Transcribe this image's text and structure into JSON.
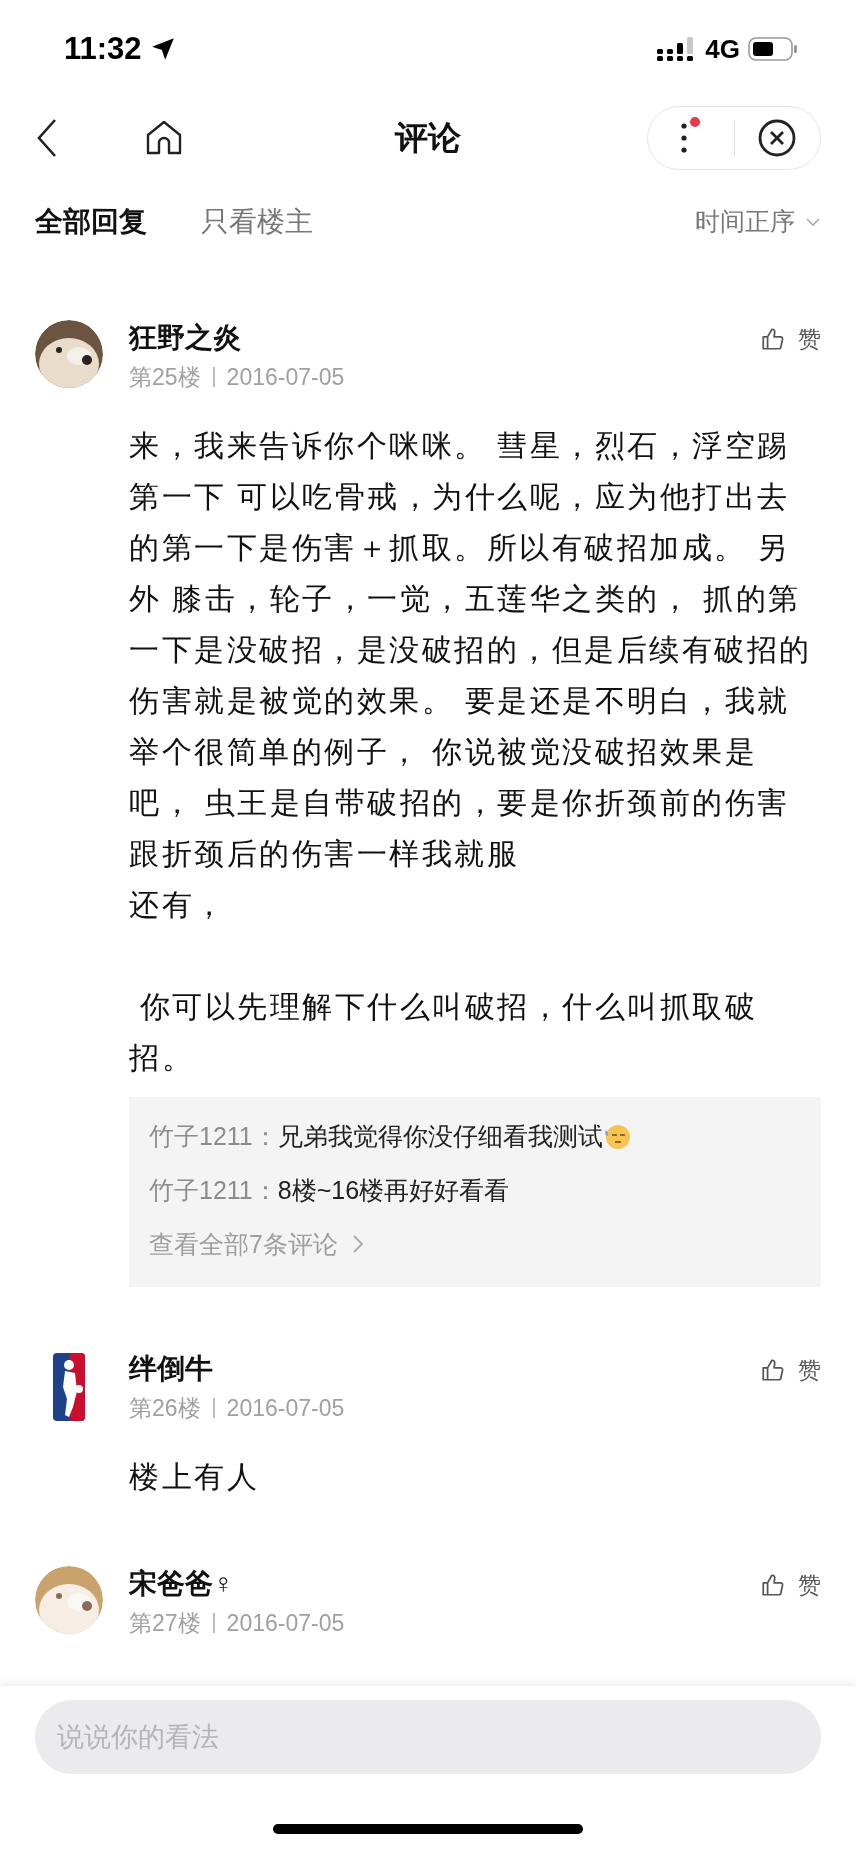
{
  "status_bar": {
    "time": "11:32",
    "network": "4G"
  },
  "nav": {
    "title": "评论"
  },
  "tabs": [
    {
      "label": "全部回复",
      "selected": true
    },
    {
      "label": "只看楼主",
      "selected": false
    }
  ],
  "sort": {
    "label": "时间正序"
  },
  "posts": [
    {
      "name": "狂野之炎",
      "floor": "第25楼",
      "date": "2016-07-05",
      "like": "赞",
      "body": [
        {
          "text": "来，我来告诉你个咪咪。 彗星，烈石，浮空踢第一下 可以吃骨戒，为什么呢，应为他打出去的第一下是伤害＋抓取。所以有破招加成。 另外 膝击，轮子，一觉，五莲华之类的， 抓的第一下是没破招，是没破招的，但是后续有破招的伤害就是被觉的效果。 要是还是不明白，我就举个很简单的例子， 你说被觉没破招效果是吧， 虫王是自带破招的，要是你折颈前的伤害跟折颈后的伤害一样我就服",
          "space_before": false
        },
        {
          "text": "还有，",
          "space_before": false
        },
        {
          "text": " 你可以先理解下什么叫破招，什么叫抓取破招。",
          "space_before": true
        }
      ],
      "replies": {
        "items": [
          {
            "author": "竹子1211：",
            "text": "兄弟我觉得你没仔细看我测试",
            "emoji": true
          },
          {
            "author": "竹子1211：",
            "text": "8楼~16楼再好好看看",
            "emoji": false
          }
        ],
        "more": "查看全部7条评论"
      }
    },
    {
      "name": "绊倒牛",
      "floor": "第26楼",
      "date": "2016-07-05",
      "like": "赞",
      "body": [
        {
          "text": "楼上有人",
          "space_before": false
        }
      ]
    },
    {
      "name": "宋爸爸♀",
      "floor": "第27楼",
      "date": "2016-07-05",
      "like": "赞"
    }
  ],
  "composer": {
    "placeholder": "说说你的看法"
  }
}
